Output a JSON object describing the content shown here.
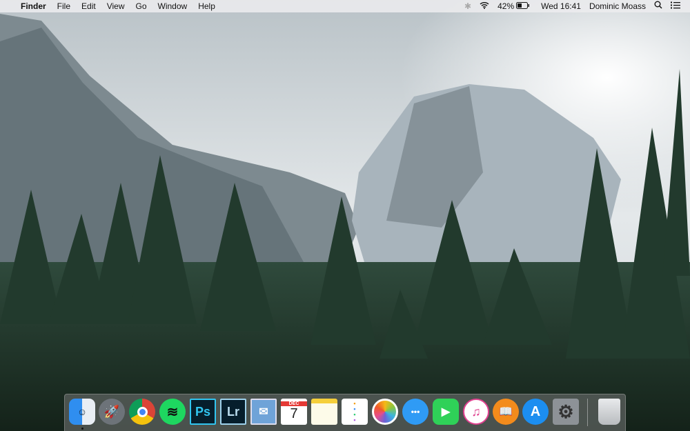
{
  "menubar": {
    "app_name": "Finder",
    "menus": [
      "File",
      "Edit",
      "View",
      "Go",
      "Window",
      "Help"
    ],
    "battery": "42%",
    "clock": "Wed 16:41",
    "user": "Dominic Moass"
  },
  "dock": {
    "apps": [
      {
        "name": "Finder",
        "label": ""
      },
      {
        "name": "Launchpad",
        "label": ""
      },
      {
        "name": "Chrome",
        "label": ""
      },
      {
        "name": "Spotify",
        "label": ""
      },
      {
        "name": "Photoshop",
        "label": "Ps"
      },
      {
        "name": "Lightroom",
        "label": "Lr"
      },
      {
        "name": "Mail",
        "label": ""
      },
      {
        "name": "Calendar",
        "label": "7",
        "month": "DEC"
      },
      {
        "name": "Notes",
        "label": ""
      },
      {
        "name": "Reminders",
        "label": ""
      },
      {
        "name": "Photos",
        "label": ""
      },
      {
        "name": "Messages",
        "label": "•••"
      },
      {
        "name": "FaceTime",
        "label": ""
      },
      {
        "name": "iTunes",
        "label": "♫"
      },
      {
        "name": "iBooks",
        "label": ""
      },
      {
        "name": "App Store",
        "label": "A"
      },
      {
        "name": "System Preferences",
        "label": "⚙"
      },
      {
        "name": "Trash",
        "label": ""
      }
    ]
  }
}
